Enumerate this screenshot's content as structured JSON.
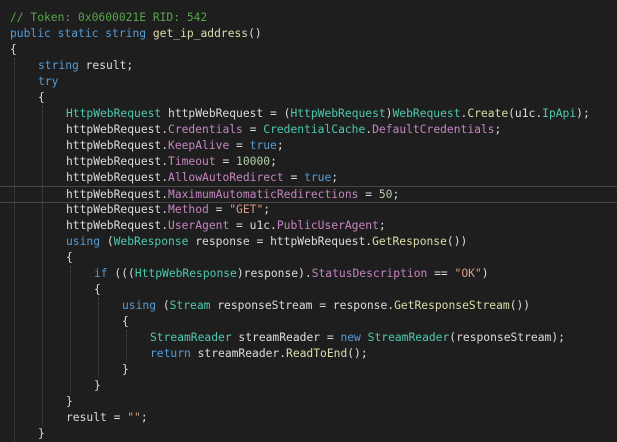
{
  "editor": {
    "colors": {
      "background": "#1e1e1e",
      "comment": "#57a64a",
      "keyword": "#569cd6",
      "method": "#dcdcaa",
      "type": "#4ec9b0",
      "text": "#dcdcdc",
      "property": "#c586c0",
      "number": "#b5cea8",
      "string": "#d69d85"
    },
    "lines": [
      {
        "indent": 0,
        "tokens": [
          {
            "t": "// Token: 0x0600021E RID: 542",
            "k": "comment"
          }
        ]
      },
      {
        "indent": 0,
        "tokens": [
          {
            "t": "public",
            "k": "keyword"
          },
          {
            "t": " "
          },
          {
            "t": "static",
            "k": "keyword"
          },
          {
            "t": " "
          },
          {
            "t": "string",
            "k": "keyword"
          },
          {
            "t": " "
          },
          {
            "t": "get_ip_address",
            "k": "method"
          },
          {
            "t": "()"
          }
        ]
      },
      {
        "indent": 0,
        "tokens": [
          {
            "t": "{"
          }
        ]
      },
      {
        "indent": 1,
        "tokens": [
          {
            "t": "string",
            "k": "keyword"
          },
          {
            "t": " result;"
          }
        ]
      },
      {
        "indent": 1,
        "tokens": [
          {
            "t": "try",
            "k": "keyword"
          }
        ]
      },
      {
        "indent": 1,
        "tokens": [
          {
            "t": "{"
          }
        ]
      },
      {
        "indent": 2,
        "tokens": [
          {
            "t": "HttpWebRequest",
            "k": "type"
          },
          {
            "t": " httpWebRequest = ("
          },
          {
            "t": "HttpWebRequest",
            "k": "type"
          },
          {
            "t": ")"
          },
          {
            "t": "WebRequest",
            "k": "type"
          },
          {
            "t": "."
          },
          {
            "t": "Create",
            "k": "method"
          },
          {
            "t": "(u1c."
          },
          {
            "t": "IpApi",
            "k": "type"
          },
          {
            "t": ");"
          }
        ]
      },
      {
        "indent": 2,
        "tokens": [
          {
            "t": "httpWebRequest."
          },
          {
            "t": "Credentials",
            "k": "property"
          },
          {
            "t": " = "
          },
          {
            "t": "CredentialCache",
            "k": "type"
          },
          {
            "t": "."
          },
          {
            "t": "DefaultCredentials",
            "k": "property"
          },
          {
            "t": ";"
          }
        ]
      },
      {
        "indent": 2,
        "tokens": [
          {
            "t": "httpWebRequest."
          },
          {
            "t": "KeepAlive",
            "k": "property"
          },
          {
            "t": " = "
          },
          {
            "t": "true",
            "k": "keyword"
          },
          {
            "t": ";"
          }
        ]
      },
      {
        "indent": 2,
        "tokens": [
          {
            "t": "httpWebRequest."
          },
          {
            "t": "Timeout",
            "k": "property"
          },
          {
            "t": " = "
          },
          {
            "t": "10000",
            "k": "number"
          },
          {
            "t": ";"
          }
        ]
      },
      {
        "indent": 2,
        "tokens": [
          {
            "t": "httpWebRequest."
          },
          {
            "t": "AllowAutoRedirect",
            "k": "property"
          },
          {
            "t": " = "
          },
          {
            "t": "true",
            "k": "keyword"
          },
          {
            "t": ";"
          }
        ]
      },
      {
        "indent": 2,
        "current": true,
        "tokens": [
          {
            "t": "httpWebRequest."
          },
          {
            "t": "MaximumAutomaticRedirections",
            "k": "property"
          },
          {
            "t": " = "
          },
          {
            "t": "50",
            "k": "number"
          },
          {
            "t": ";"
          }
        ]
      },
      {
        "indent": 2,
        "tokens": [
          {
            "t": "httpWebRequest."
          },
          {
            "t": "Method",
            "k": "property"
          },
          {
            "t": " = "
          },
          {
            "t": "\"GET\"",
            "k": "string"
          },
          {
            "t": ";"
          }
        ]
      },
      {
        "indent": 2,
        "tokens": [
          {
            "t": "httpWebRequest."
          },
          {
            "t": "UserAgent",
            "k": "property"
          },
          {
            "t": " = u1c."
          },
          {
            "t": "PublicUserAgent",
            "k": "property"
          },
          {
            "t": ";"
          }
        ]
      },
      {
        "indent": 2,
        "tokens": [
          {
            "t": "using",
            "k": "keyword"
          },
          {
            "t": " ("
          },
          {
            "t": "WebResponse",
            "k": "type"
          },
          {
            "t": " response = httpWebRequest."
          },
          {
            "t": "GetResponse",
            "k": "method"
          },
          {
            "t": "())"
          }
        ]
      },
      {
        "indent": 2,
        "tokens": [
          {
            "t": "{"
          }
        ]
      },
      {
        "indent": 3,
        "tokens": [
          {
            "t": "if",
            "k": "keyword"
          },
          {
            "t": " ((("
          },
          {
            "t": "HttpWebResponse",
            "k": "type"
          },
          {
            "t": ")response)."
          },
          {
            "t": "StatusDescription",
            "k": "property"
          },
          {
            "t": " == "
          },
          {
            "t": "\"OK\"",
            "k": "string"
          },
          {
            "t": ")"
          }
        ]
      },
      {
        "indent": 3,
        "tokens": [
          {
            "t": "{"
          }
        ]
      },
      {
        "indent": 4,
        "tokens": [
          {
            "t": "using",
            "k": "keyword"
          },
          {
            "t": " ("
          },
          {
            "t": "Stream",
            "k": "type"
          },
          {
            "t": " responseStream = response."
          },
          {
            "t": "GetResponseStream",
            "k": "method"
          },
          {
            "t": "())"
          }
        ]
      },
      {
        "indent": 4,
        "tokens": [
          {
            "t": "{"
          }
        ]
      },
      {
        "indent": 5,
        "tokens": [
          {
            "t": "StreamReader",
            "k": "type"
          },
          {
            "t": " streamReader = "
          },
          {
            "t": "new",
            "k": "keyword"
          },
          {
            "t": " "
          },
          {
            "t": "StreamReader",
            "k": "type"
          },
          {
            "t": "(responseStream);"
          }
        ]
      },
      {
        "indent": 5,
        "tokens": [
          {
            "t": "return",
            "k": "keyword"
          },
          {
            "t": " streamReader."
          },
          {
            "t": "ReadToEnd",
            "k": "method"
          },
          {
            "t": "();"
          }
        ]
      },
      {
        "indent": 4,
        "tokens": [
          {
            "t": "}"
          }
        ]
      },
      {
        "indent": 3,
        "tokens": [
          {
            "t": "}"
          }
        ]
      },
      {
        "indent": 2,
        "tokens": [
          {
            "t": "}"
          }
        ]
      },
      {
        "indent": 2,
        "tokens": [
          {
            "t": "result = "
          },
          {
            "t": "\"\"",
            "k": "string"
          },
          {
            "t": ";"
          }
        ]
      },
      {
        "indent": 1,
        "tokens": [
          {
            "t": "}"
          }
        ]
      }
    ]
  }
}
